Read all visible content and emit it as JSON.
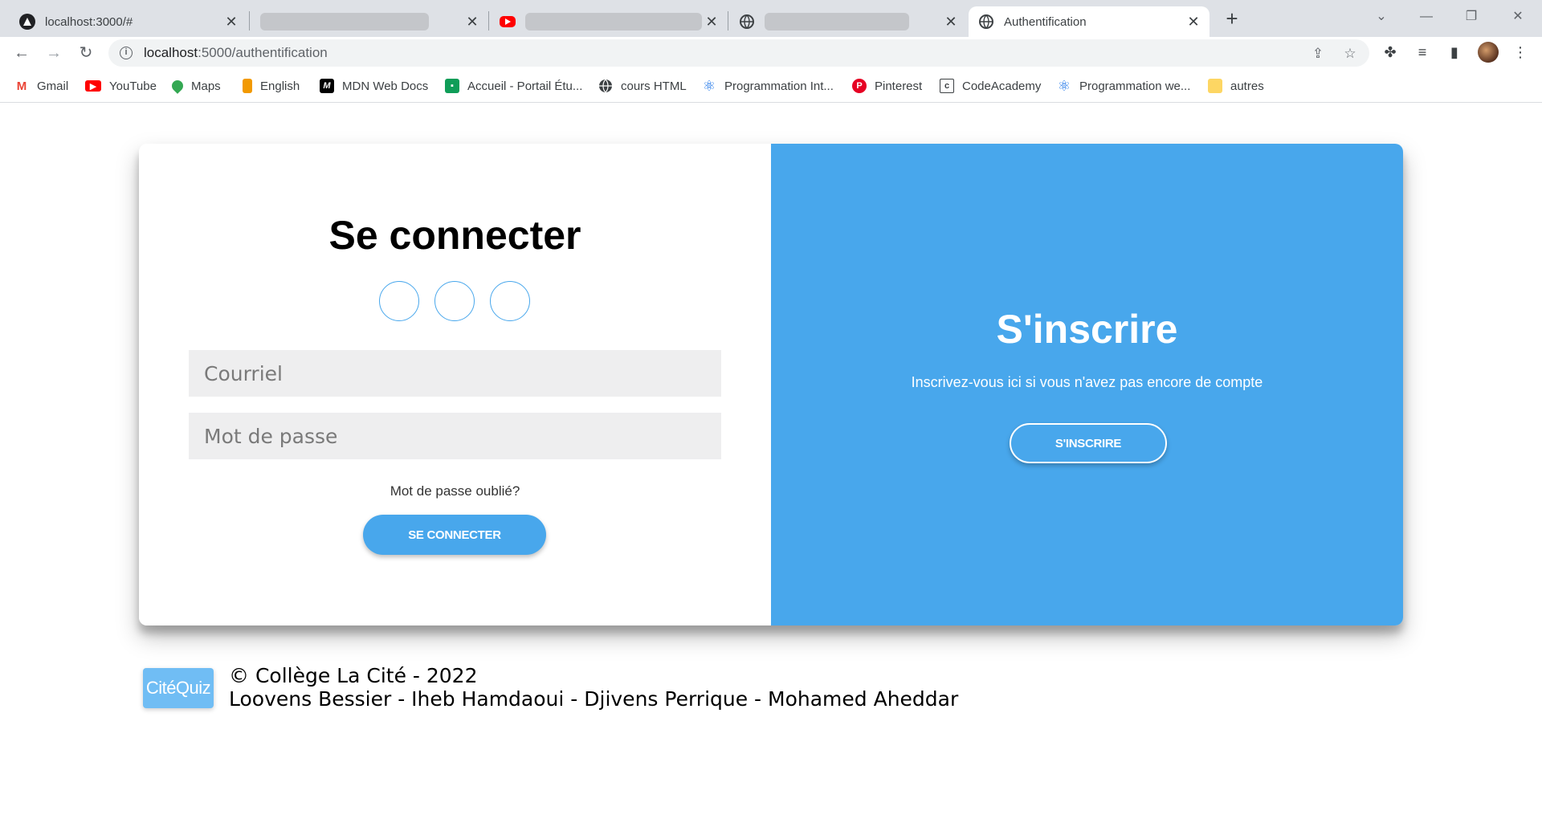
{
  "browser": {
    "tabs": [
      {
        "title": "localhost:3000/#",
        "icon": "app-triangle-icon"
      },
      {
        "title": "",
        "icon": "blank-icon"
      },
      {
        "title": "",
        "icon": "youtube-icon"
      },
      {
        "title": "",
        "icon": "globe-icon"
      },
      {
        "title": "Authentification",
        "icon": "globe-icon",
        "active": true
      }
    ],
    "url_host": "localhost",
    "url_rest": ":5000/authentification",
    "bookmarks": [
      {
        "label": "Gmail",
        "icon": "gmail-icon",
        "color": "#ea4335"
      },
      {
        "label": "YouTube",
        "icon": "youtube-icon",
        "color": "#ff0000"
      },
      {
        "label": "Maps",
        "icon": "maps-icon",
        "color": "#34a853"
      },
      {
        "label": "English",
        "icon": "english-icon",
        "color": "#f29900"
      },
      {
        "label": "MDN Web Docs",
        "icon": "mdn-icon",
        "color": "#000000"
      },
      {
        "label": "Accueil - Portail Étu...",
        "icon": "portal-icon",
        "color": "#0f9d58"
      },
      {
        "label": "cours HTML",
        "icon": "globe-icon",
        "color": "#3c4043"
      },
      {
        "label": "Programmation Int...",
        "icon": "react-icon",
        "color": "#1a73e8"
      },
      {
        "label": "Pinterest",
        "icon": "pinterest-icon",
        "color": "#e60023"
      },
      {
        "label": "CodeAcademy",
        "icon": "codeacademy-icon",
        "color": "#3c4043"
      },
      {
        "label": "Programmation we...",
        "icon": "react-icon",
        "color": "#1a73e8"
      },
      {
        "label": "autres",
        "icon": "folder-icon",
        "color": "#fdd663"
      }
    ]
  },
  "login": {
    "title": "Se connecter",
    "email_placeholder": "Courriel",
    "password_placeholder": "Mot de passe",
    "forgot": "Mot de passe oublié?",
    "button": "SE CONNECTER"
  },
  "signup": {
    "title": "S'inscrire",
    "text": "Inscrivez-vous ici si vous n'avez pas encore de compte",
    "button": "S'INSCRIRE"
  },
  "footer": {
    "logo": "CitéQuiz",
    "copyright": "© Collège La Cité - 2022",
    "authors": "Loovens Bessier - Iheb Hamdaoui - Djivens Perrique - Mohamed Aheddar"
  },
  "colors": {
    "accent": "#48a7ec",
    "field_bg": "#eeeeef"
  }
}
